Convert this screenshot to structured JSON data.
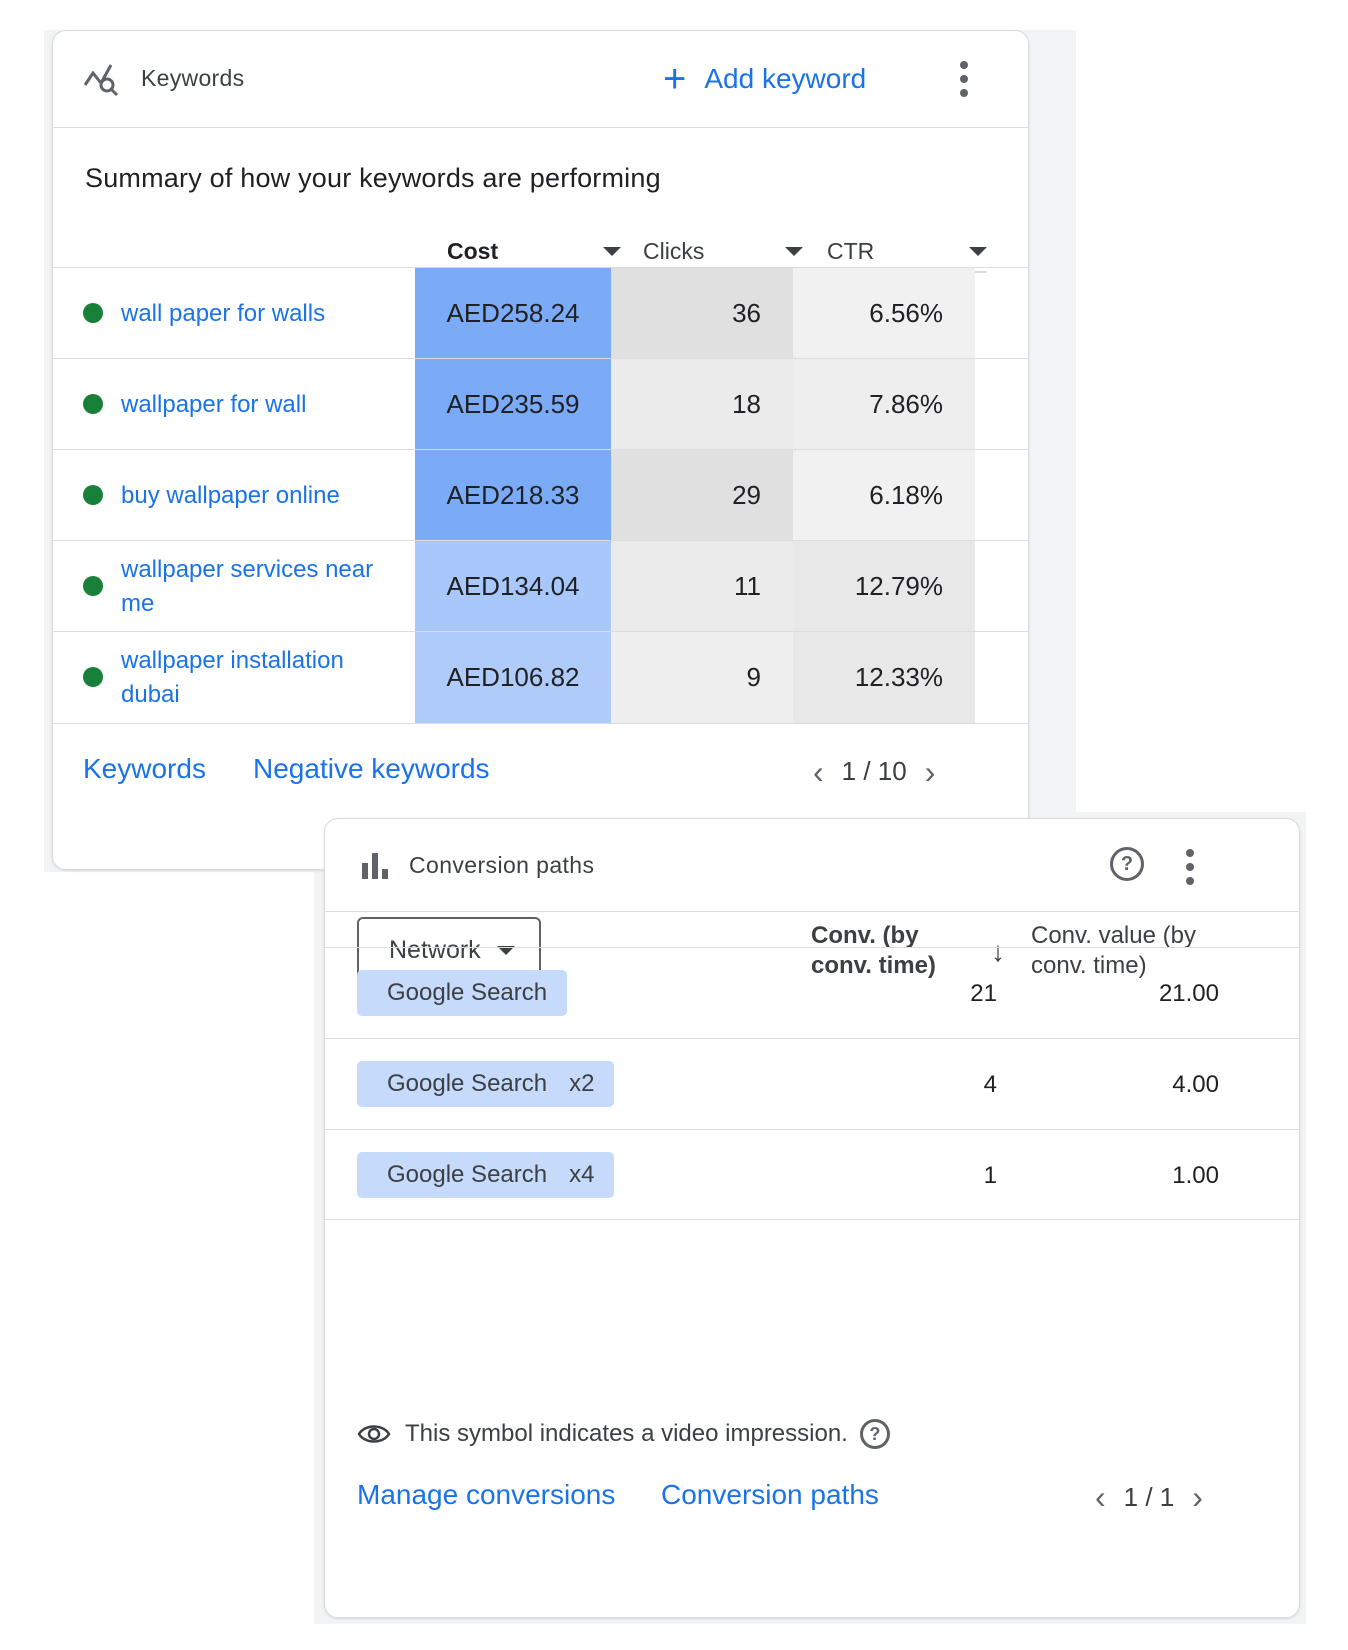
{
  "keywords_card": {
    "title": "Keywords",
    "add_keyword_label": "Add keyword",
    "summary": "Summary of how your keywords are performing",
    "columns": {
      "cost": "Cost",
      "clicks": "Clicks",
      "ctr": "CTR"
    },
    "rows": [
      {
        "keyword": "wall paper for walls",
        "cost": "AED258.24",
        "clicks": "36",
        "ctr": "6.56%",
        "cost_color": "#7baaf7",
        "clicks_color": "#e0e0e0",
        "ctr_color": "#f1f1f1"
      },
      {
        "keyword": "wallpaper for wall",
        "cost": "AED235.59",
        "clicks": "18",
        "ctr": "7.86%",
        "cost_color": "#7baaf7",
        "clicks_color": "#ebebeb",
        "ctr_color": "#eeeeee"
      },
      {
        "keyword": "buy wallpaper online",
        "cost": "AED218.33",
        "clicks": "29",
        "ctr": "6.18%",
        "cost_color": "#7baaf7",
        "clicks_color": "#e0e0e0",
        "ctr_color": "#f1f1f1"
      },
      {
        "keyword": "wallpaper services near me",
        "cost": "AED134.04",
        "clicks": "11",
        "ctr": "12.79%",
        "cost_color": "#a8c7fa",
        "clicks_color": "#ebebeb",
        "ctr_color": "#e8e8e8"
      },
      {
        "keyword": "wallpaper installation dubai",
        "cost": "AED106.82",
        "clicks": "9",
        "ctr": "12.33%",
        "cost_color": "#aecbfa",
        "clicks_color": "#eeeeee",
        "ctr_color": "#e8e8e8"
      }
    ],
    "footer_links": {
      "keywords": "Keywords",
      "negative_keywords": "Negative keywords"
    },
    "pager": {
      "text": "1 / 10"
    },
    "status_color": "#188038"
  },
  "conversion_paths_card": {
    "title": "Conversion paths",
    "network_label": "Network",
    "columns": {
      "conv": "Conv. (by conv. time)",
      "value": "Conv. value (by conv. time)"
    },
    "rows": [
      {
        "path": "Google Search",
        "multiplier": "",
        "conv": "21",
        "value": "21.00"
      },
      {
        "path": "Google Search",
        "multiplier": "x2",
        "conv": "4",
        "value": "4.00"
      },
      {
        "path": "Google Search",
        "multiplier": "x4",
        "conv": "1",
        "value": "1.00"
      }
    ],
    "note": "This symbol indicates a video impression.",
    "footer_links": {
      "manage": "Manage conversions",
      "paths": "Conversion paths"
    },
    "pager": "1 / 1",
    "chip_color": "#c6dafc"
  }
}
